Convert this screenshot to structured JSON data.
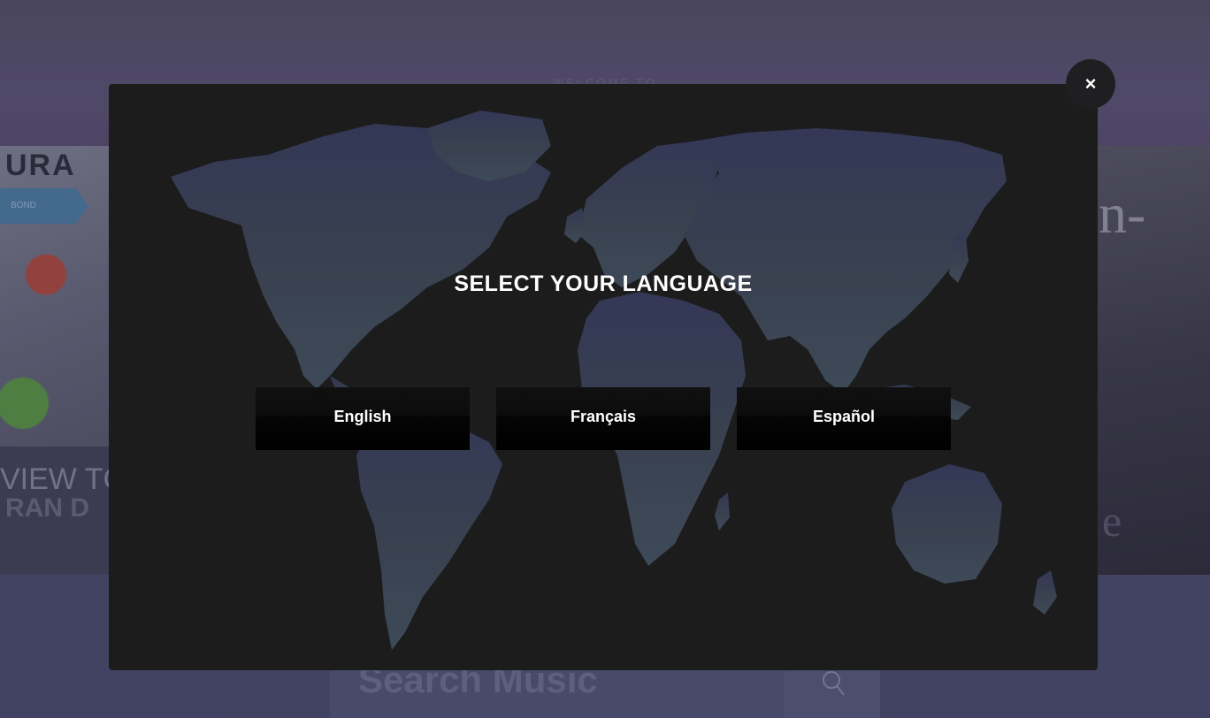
{
  "background": {
    "welcome_text": "WELCOME TO",
    "left_slide": {
      "top_text": "URA",
      "tag_label": "BOND",
      "caption_line1": "VIEW TC",
      "caption_line2": "RAN D"
    },
    "right_slide": {
      "text": "n-",
      "text2": "e"
    },
    "search": {
      "placeholder": "Search Music",
      "icon": "search-icon"
    }
  },
  "modal": {
    "title": "SELECT YOUR LANGUAGE",
    "languages": [
      "English",
      "Français",
      "Español"
    ],
    "close_label": "×",
    "close_icon": "close-icon",
    "map_color": "#3b4254"
  }
}
